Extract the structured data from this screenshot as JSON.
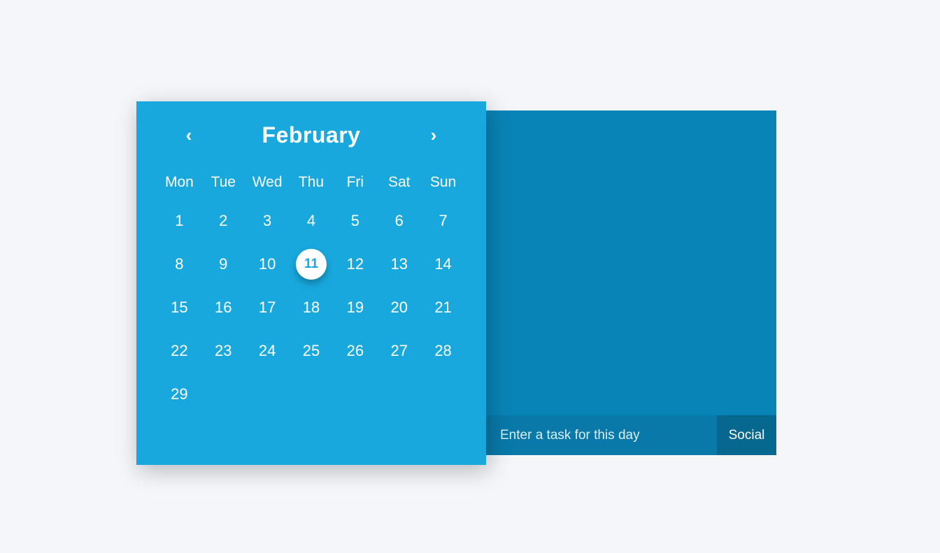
{
  "calendar": {
    "month_label": "February",
    "weekdays": [
      "Mon",
      "Tue",
      "Wed",
      "Thu",
      "Fri",
      "Sat",
      "Sun"
    ],
    "days": [
      1,
      2,
      3,
      4,
      5,
      6,
      7,
      8,
      9,
      10,
      11,
      12,
      13,
      14,
      15,
      16,
      17,
      18,
      19,
      20,
      21,
      22,
      23,
      24,
      25,
      26,
      27,
      28,
      29
    ],
    "selected_day": 11
  },
  "task_panel": {
    "input_placeholder": "Enter a task for this day",
    "category_label": "Social"
  },
  "colors": {
    "calendar_bg": "#18a8dd",
    "panel_bg": "#0984b7",
    "page_bg": "#f4f6fa"
  }
}
